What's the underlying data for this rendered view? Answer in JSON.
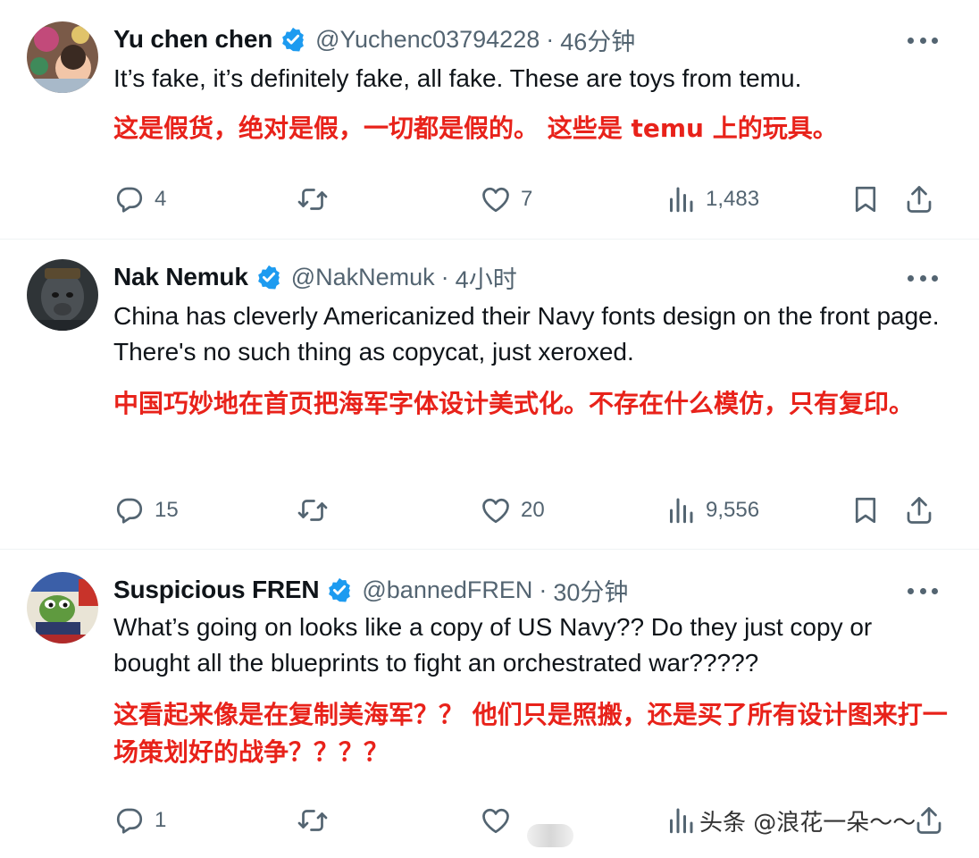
{
  "tweets": [
    {
      "name": "Yu chen chen",
      "handle": "@Yuchenc03794228",
      "separator": "·",
      "time": "46分钟",
      "text": "It’s fake,  it’s definitely fake, all fake.  These are toys from temu.",
      "translation": "这是假货，绝对是假，一切都是假的。 这些是 temu 上的玩具。",
      "replies": "4",
      "retweets": "",
      "likes": "7",
      "views": "1,483"
    },
    {
      "name": "Nak Nemuk",
      "handle": "@NakNemuk",
      "separator": "·",
      "time": "4小时",
      "text": "China has cleverly Americanized their Navy fonts design on the front page. There's no such thing as copycat, just xeroxed.",
      "translation": "中国巧妙地在首页把海军字体设计美式化。不存在什么模仿，只有复印。",
      "replies": "15",
      "retweets": "",
      "likes": "20",
      "views": "9,556"
    },
    {
      "name": "Suspicious FREN",
      "handle": "@bannedFREN",
      "separator": "·",
      "time": "30分钟",
      "text": "What’s going on looks like a copy of US Navy?? Do they just copy or bought all the blueprints to fight an orchestrated war?????",
      "translation": "这看起来像是在复制美海军？？ 他们只是照搬，还是买了所有设计图来打一场策划好的战争？？？？",
      "replies": "1",
      "retweets": "",
      "likes": "",
      "views": ""
    }
  ],
  "watermark": "头条 @浪花一朵～～",
  "colors": {
    "text": "#0f1419",
    "secondary": "#536471",
    "verified": "#1d9bf0",
    "translation": "#e8221a",
    "divider": "#eff3f4"
  },
  "icons": [
    "verified-badge-icon",
    "more-options-icon",
    "reply-icon",
    "retweet-icon",
    "like-icon",
    "views-icon",
    "bookmark-icon",
    "share-icon"
  ]
}
